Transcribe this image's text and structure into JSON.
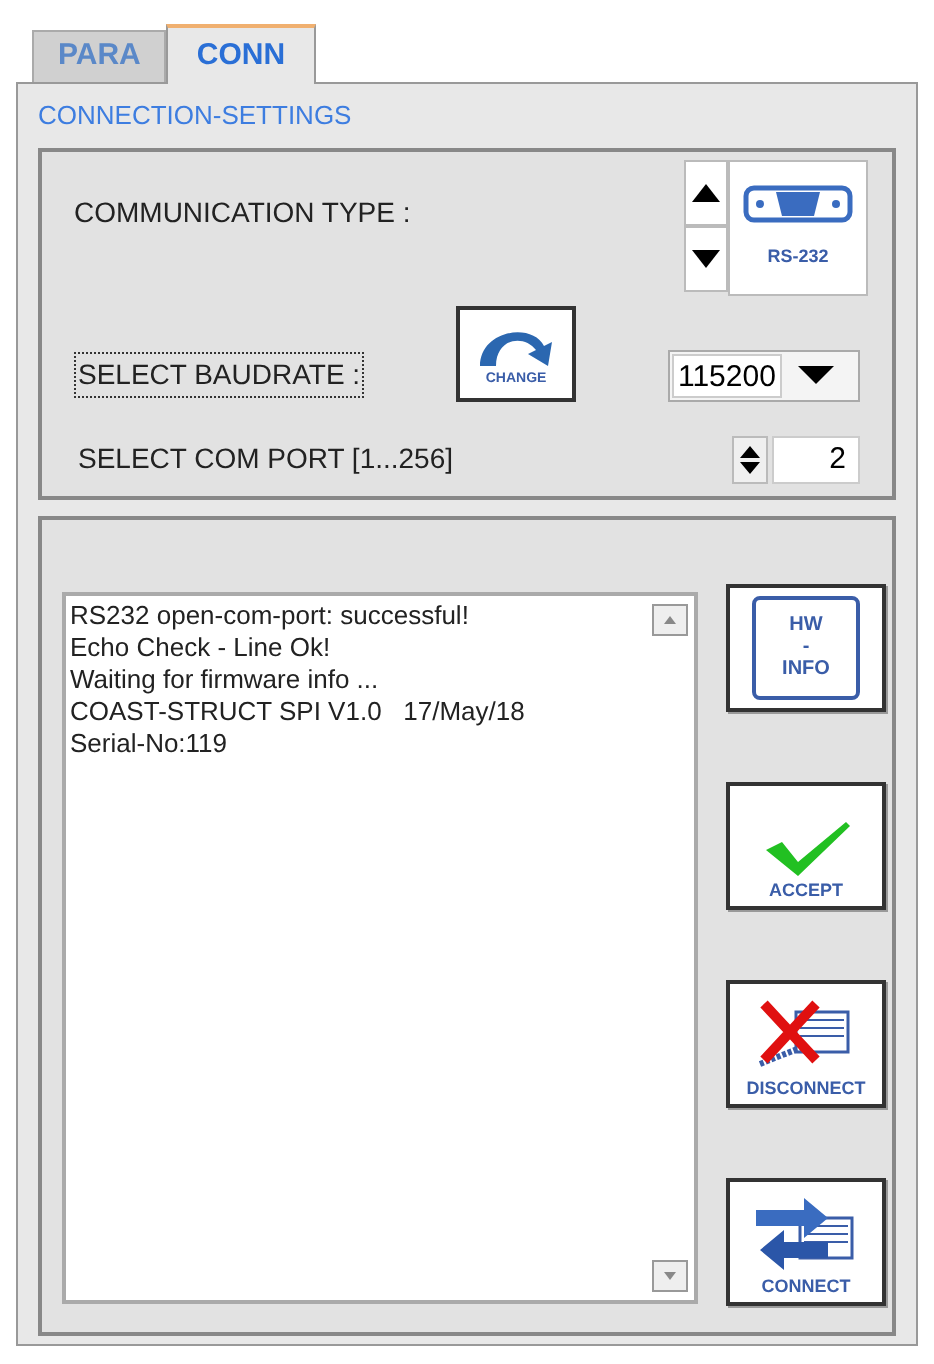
{
  "tabs": [
    {
      "label": "PARA",
      "selected": false
    },
    {
      "label": "CONN",
      "selected": true
    }
  ],
  "section_title": "CONNECTION-SETTINGS",
  "communication_type": {
    "label": "COMMUNICATION TYPE :",
    "button_label": "RS-232"
  },
  "baudrate": {
    "label": "SELECT BAUDRATE :",
    "focused": true,
    "change_button": "CHANGE",
    "value": "115200"
  },
  "com_port": {
    "label": "SELECT COM PORT [1...256]",
    "value": "2"
  },
  "log_lines": [
    "RS232 open-com-port: successful!",
    "Echo Check - Line Ok!",
    "Waiting for firmware info ...",
    "COAST-STRUCT SPI V1.0   17/May/18",
    "Serial-No:119"
  ],
  "actions": [
    {
      "kind": "info",
      "label_top": "HW",
      "label_mid": "-",
      "label": "INFO"
    },
    {
      "kind": "accept",
      "label": "ACCEPT"
    },
    {
      "kind": "disconnect",
      "label": "DISCONNECT"
    },
    {
      "kind": "connect",
      "label": "CONNECT"
    }
  ]
}
